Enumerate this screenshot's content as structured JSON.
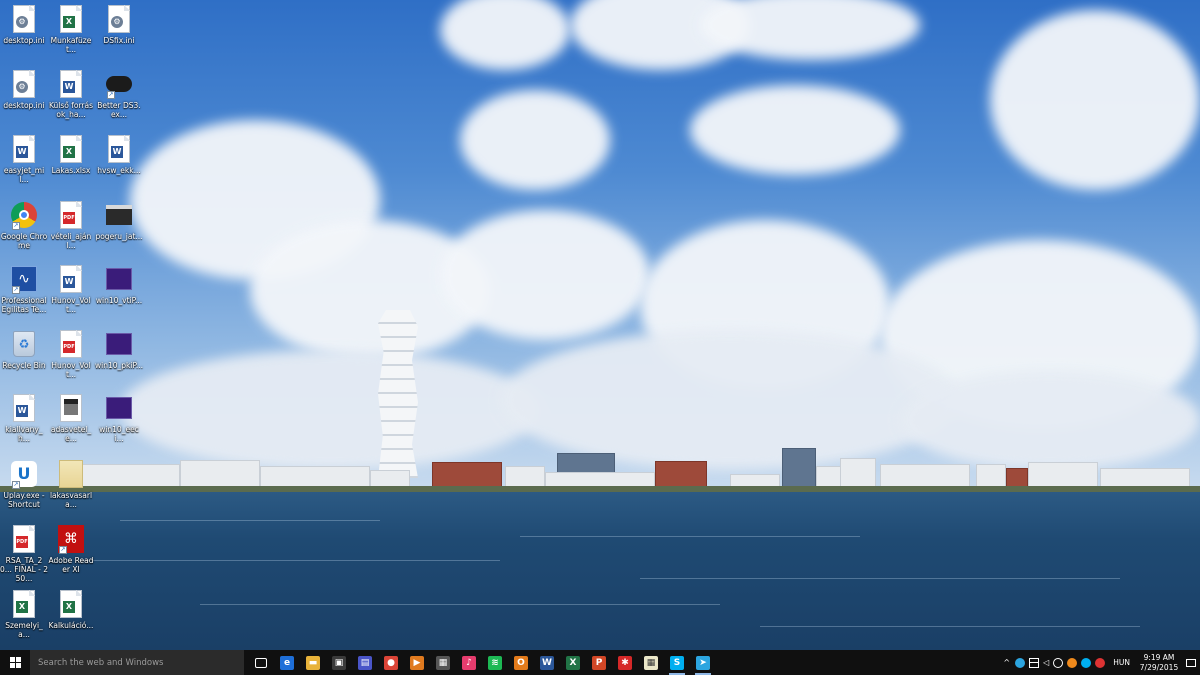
{
  "desktop": {
    "icons": [
      {
        "label": "desktop.ini",
        "type": "ini"
      },
      {
        "label": "Munkafüzet...",
        "type": "excel"
      },
      {
        "label": "DSfix.ini",
        "type": "ini"
      },
      {
        "label": "desktop.ini",
        "type": "ini"
      },
      {
        "label": "Külső források_ha...",
        "type": "word"
      },
      {
        "label": "Better DS3.ex...",
        "type": "gamepad"
      },
      {
        "label": "easyjet_mil...",
        "type": "word"
      },
      {
        "label": "Lakas.xlsx",
        "type": "excel"
      },
      {
        "label": "hvsw_ekk...",
        "type": "word"
      },
      {
        "label": "Google Chrome",
        "type": "chrome"
      },
      {
        "label": "vételi_ajánl...",
        "type": "pdf"
      },
      {
        "label": "pogeru_jat...",
        "type": "terminal"
      },
      {
        "label": "Professional Egilitas Te...",
        "type": "pe"
      },
      {
        "label": "Hunov_Volt...",
        "type": "word"
      },
      {
        "label": "win10_vtiP...",
        "type": "ps"
      },
      {
        "label": "Recycle Bin",
        "type": "recycle"
      },
      {
        "label": "Hunov_Volt...",
        "type": "pdf"
      },
      {
        "label": "win10_pkiP...",
        "type": "ps"
      },
      {
        "label": "kiallvany_h...",
        "type": "word"
      },
      {
        "label": "adasvetel_e...",
        "type": "image"
      },
      {
        "label": "win10_eeci...",
        "type": "ps"
      },
      {
        "label": "Uplay.exe - Shortcut",
        "type": "uplay"
      },
      {
        "label": "lakasvasarla...",
        "type": "thumb"
      },
      {
        "label": "RSA_TA_20... FINAL - 250...",
        "type": "pdf"
      },
      {
        "label": "Adobe Reader XI",
        "type": "acrobat"
      },
      {
        "label": "Szemelyi_a...",
        "type": "excel"
      },
      {
        "label": "Kalkuláció...",
        "type": "excel"
      }
    ]
  },
  "taskbar": {
    "search_placeholder": "Search the web and Windows",
    "apps": [
      {
        "name": "task-view-icon",
        "glyph": "▭",
        "color": "#101010"
      },
      {
        "name": "edge-icon",
        "glyph": "e",
        "color": "#1e6fd9"
      },
      {
        "name": "file-explorer-icon",
        "glyph": "▬",
        "color": "#e8b33a"
      },
      {
        "name": "store-icon",
        "glyph": "▣",
        "color": "#3a3a3a"
      },
      {
        "name": "save-disk-icon",
        "glyph": "▤",
        "color": "#4a55c8"
      },
      {
        "name": "chrome-icon",
        "glyph": "●",
        "color": "#db4437"
      },
      {
        "name": "media-player-icon",
        "glyph": "▶",
        "color": "#e07a1f"
      },
      {
        "name": "movie-maker-icon",
        "glyph": "▦",
        "color": "#555555"
      },
      {
        "name": "itunes-icon",
        "glyph": "♪",
        "color": "#e63c6e"
      },
      {
        "name": "spotify-icon",
        "glyph": "≋",
        "color": "#1db954"
      },
      {
        "name": "outlook-icon",
        "glyph": "O",
        "color": "#e37b1b"
      },
      {
        "name": "word-icon",
        "glyph": "W",
        "color": "#2b579a"
      },
      {
        "name": "excel-icon",
        "glyph": "X",
        "color": "#217346"
      },
      {
        "name": "powerpoint-icon",
        "glyph": "P",
        "color": "#d24726"
      },
      {
        "name": "puzzle-icon",
        "glyph": "✱",
        "color": "#d62828"
      },
      {
        "name": "calculator-icon",
        "glyph": "▦",
        "color": "#eae6c8"
      },
      {
        "name": "skype-icon",
        "glyph": "S",
        "color": "#00aff0"
      },
      {
        "name": "telegram-icon",
        "glyph": "➤",
        "color": "#2ca5e0"
      }
    ],
    "tray": {
      "language": "HUN",
      "time": "9:19 AM",
      "date": "7/29/2015"
    }
  }
}
